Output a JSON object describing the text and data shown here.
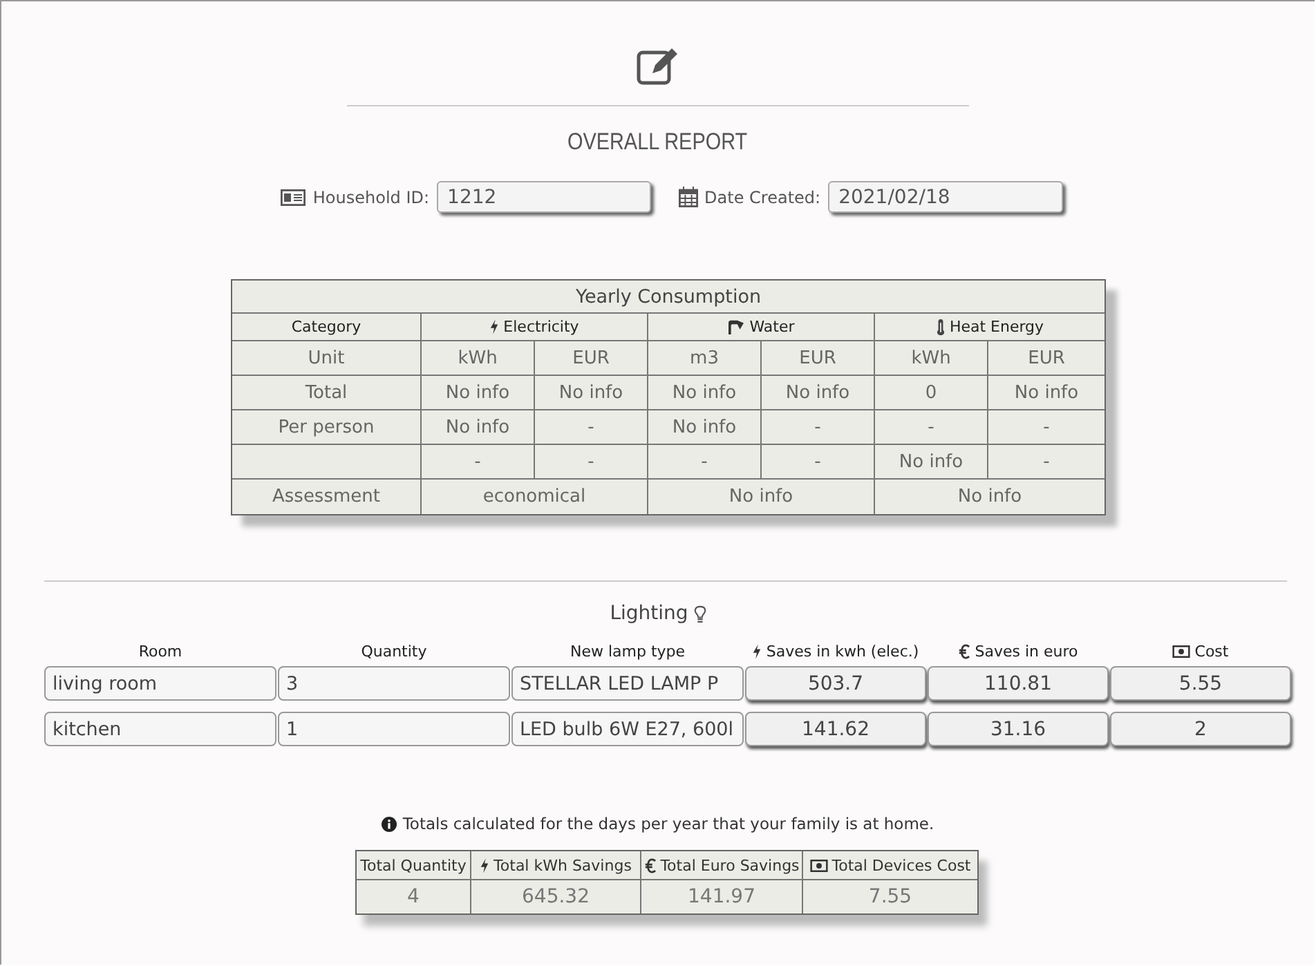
{
  "report": {
    "title": "OVERALL REPORT",
    "fields": [
      {
        "kind": "id",
        "label": "Household ID:",
        "value": "1212"
      },
      {
        "kind": "date",
        "label": "Date Created:",
        "value": "2021/02/18"
      }
    ]
  },
  "consumption": {
    "title": "Yearly Consumption",
    "headers": [
      {
        "label": "Category"
      },
      {
        "label": "Electricity"
      },
      {
        "label": "Water"
      },
      {
        "label": "Heat Energy"
      }
    ],
    "rows": [
      {
        "label": "Unit",
        "cells": [
          "kWh",
          "EUR",
          "m3",
          "EUR",
          "kWh",
          "EUR"
        ]
      },
      {
        "label": "Total",
        "cells": [
          "No info",
          "No info",
          "No info",
          "No info",
          "0",
          "No info"
        ]
      },
      {
        "label": "Per person",
        "cells": [
          "No info",
          "-",
          "No info",
          "-",
          "-",
          "-"
        ]
      },
      {
        "cells": [
          "-",
          "-",
          "-",
          "-",
          "No info",
          "-"
        ]
      },
      {
        "label": "Assessment",
        "cells": [
          "economical",
          "No info",
          "No info"
        ]
      }
    ]
  },
  "lighting": {
    "title": "Lighting",
    "columns": [
      {
        "label": "Room"
      },
      {
        "label": "Quantity"
      },
      {
        "label": "New lamp type"
      },
      {
        "label": "Saves in kwh (elec.)"
      },
      {
        "label": "Saves in euro"
      },
      {
        "label": "Cost"
      }
    ],
    "rows": [
      {
        "room": "living room",
        "quantity": "3",
        "lamp_type": "STELLAR LED LAMP P",
        "saves_kwh": "503.7",
        "saves_euro": "110.81",
        "cost": "5.55"
      },
      {
        "room": "kitchen",
        "quantity": "1",
        "lamp_type": "LED bulb 6W E27, 600l",
        "saves_kwh": "141.62",
        "saves_euro": "31.16",
        "cost": "2"
      }
    ]
  },
  "note": "Totals calculated for the days per year that your family is at home.",
  "totals": {
    "columns": [
      {
        "label": "Total Quantity"
      },
      {
        "label": "Total kWh Savings"
      },
      {
        "label": "Total Euro Savings"
      },
      {
        "label": "Total Devices Cost"
      }
    ],
    "values": [
      "4",
      "645.32",
      "141.97",
      "7.55"
    ]
  }
}
